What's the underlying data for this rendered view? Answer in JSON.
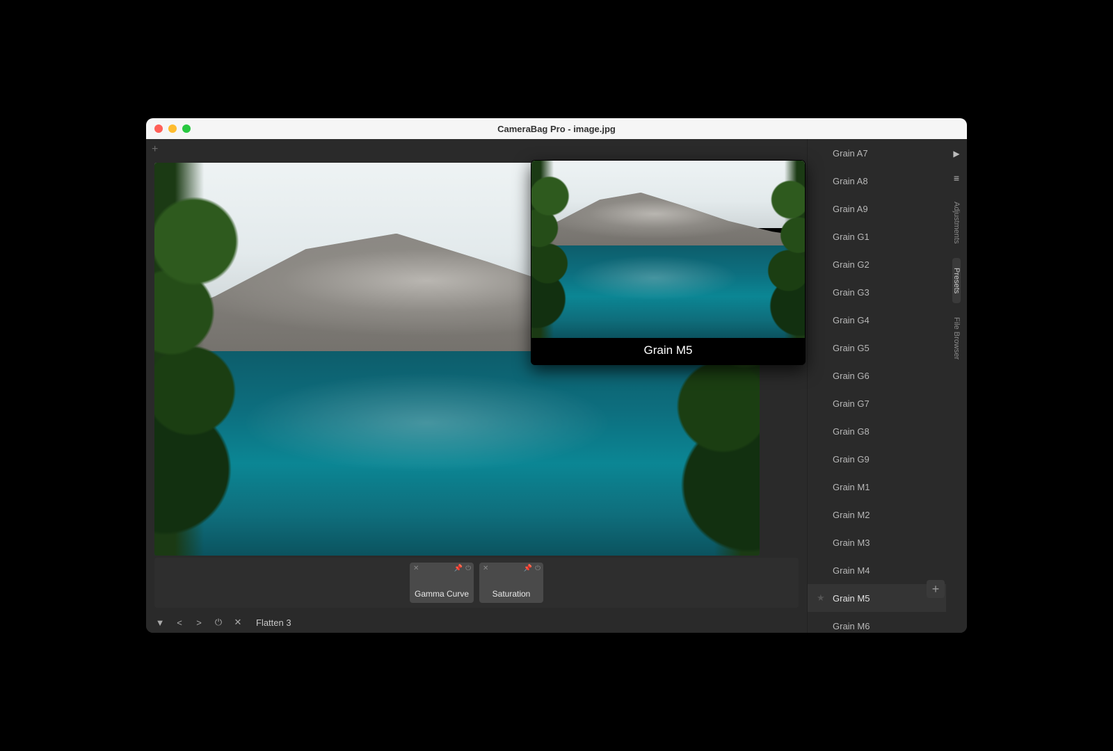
{
  "window": {
    "title": "CameraBag Pro - image.jpg"
  },
  "preview": {
    "label": "Grain M5"
  },
  "tiles": [
    {
      "label": "Gamma Curve"
    },
    {
      "label": "Saturation"
    }
  ],
  "footer": {
    "text": "Flatten 3"
  },
  "presets": {
    "items": [
      "Grain A7",
      "Grain A8",
      "Grain A9",
      "Grain G1",
      "Grain G2",
      "Grain G3",
      "Grain G4",
      "Grain G5",
      "Grain G6",
      "Grain G7",
      "Grain G8",
      "Grain G9",
      "Grain M1",
      "Grain M2",
      "Grain M3",
      "Grain M4",
      "Grain M5",
      "Grain M6"
    ],
    "selected": "Grain M5"
  },
  "vtabs": {
    "items": [
      "Adjustments",
      "Presets",
      "File Browser"
    ],
    "active": "Presets"
  }
}
